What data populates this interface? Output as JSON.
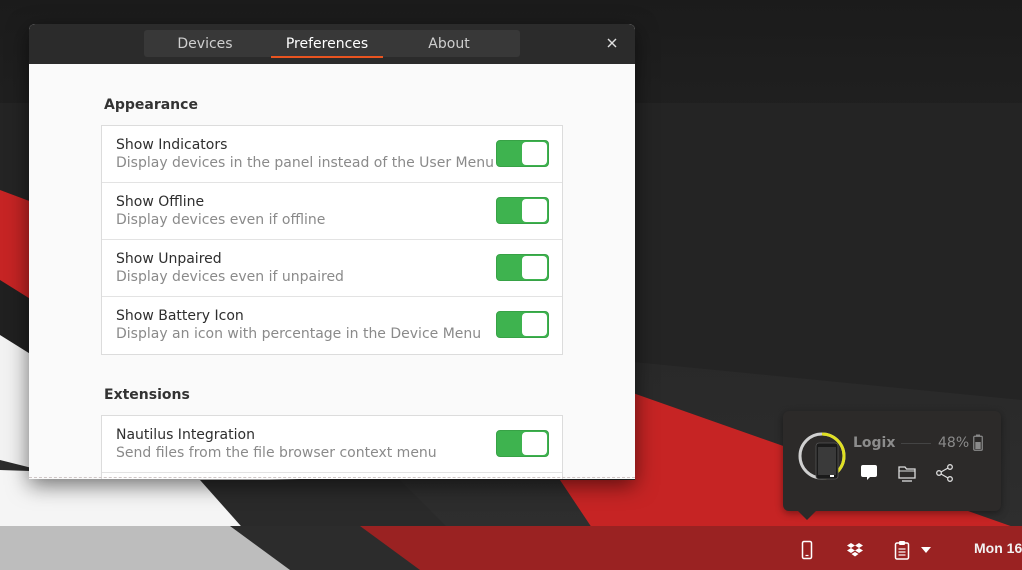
{
  "dialog": {
    "tabs": [
      {
        "label": "Devices",
        "active": false
      },
      {
        "label": "Preferences",
        "active": true
      },
      {
        "label": "About",
        "active": false
      }
    ],
    "close_label": "×",
    "accent_color": "#e95420",
    "switch_color": "#3eb34f",
    "sections": [
      {
        "title": "Appearance",
        "rows": [
          {
            "title": "Show Indicators",
            "subtitle": "Display devices in the panel instead of the User Menu",
            "enabled": true
          },
          {
            "title": "Show Offline",
            "subtitle": "Display devices even if offline",
            "enabled": true
          },
          {
            "title": "Show Unpaired",
            "subtitle": "Display devices even if unpaired",
            "enabled": true
          },
          {
            "title": "Show Battery Icon",
            "subtitle": "Display an icon with percentage in the Device Menu",
            "enabled": true
          }
        ]
      },
      {
        "title": "Extensions",
        "rows": [
          {
            "title": "Nautilus Integration",
            "subtitle": "Send files from the file browser context menu",
            "enabled": true
          }
        ]
      }
    ]
  },
  "device_popover": {
    "device_name": "Logix",
    "battery_percent_label": "48%",
    "battery_level": 0.48,
    "ring_color": "#e0e022",
    "actions": [
      {
        "name": "sms",
        "icon": "message-bubble-icon"
      },
      {
        "name": "browse-files",
        "icon": "folder-icon"
      },
      {
        "name": "share",
        "icon": "share-icon"
      }
    ]
  },
  "top_panel": {
    "tray_icons": [
      "phone-icon",
      "dropbox-icon",
      "clipboard-icon",
      "dropdown-arrow-icon"
    ],
    "clock": "Mon 16"
  }
}
